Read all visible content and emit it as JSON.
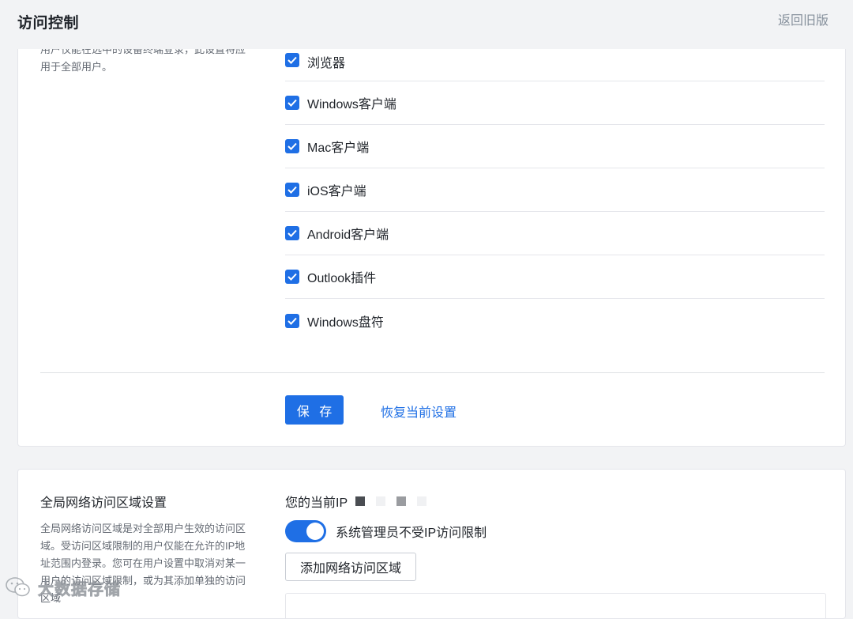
{
  "header": {
    "title": "访问控制",
    "back_label": "返回旧版"
  },
  "login_section": {
    "description": "用户仅能在选中的设备终端登录，此设置将应用于全部用户。",
    "options": [
      {
        "label": "浏览器",
        "checked": true
      },
      {
        "label": "Windows客户端",
        "checked": true
      },
      {
        "label": "Mac客户端",
        "checked": true
      },
      {
        "label": "iOS客户端",
        "checked": true
      },
      {
        "label": "Android客户端",
        "checked": true
      },
      {
        "label": "Outlook插件",
        "checked": true
      },
      {
        "label": "Windows盘符",
        "checked": true
      }
    ],
    "save_label": "保 存",
    "restore_label": "恢复当前设置"
  },
  "network_section": {
    "title": "全局网络访问区域设置",
    "description": "全局网络访问区域是对全部用户生效的访问区域。受访问区域限制的用户仅能在允许的IP地址范围内登录。您可在用户设置中取消对某一用户的访问区域限制，或为其添加单独的访问区域",
    "current_ip_label": "您的当前IP",
    "admin_toggle_label": "系统管理员不受IP访问限制",
    "admin_toggle_on": true,
    "add_zone_label": "添加网络访问区域"
  },
  "watermark": {
    "text": "大数据存储"
  },
  "colors": {
    "accent": "#1f6fe5",
    "background": "#f2f3f5",
    "card": "#ffffff"
  }
}
